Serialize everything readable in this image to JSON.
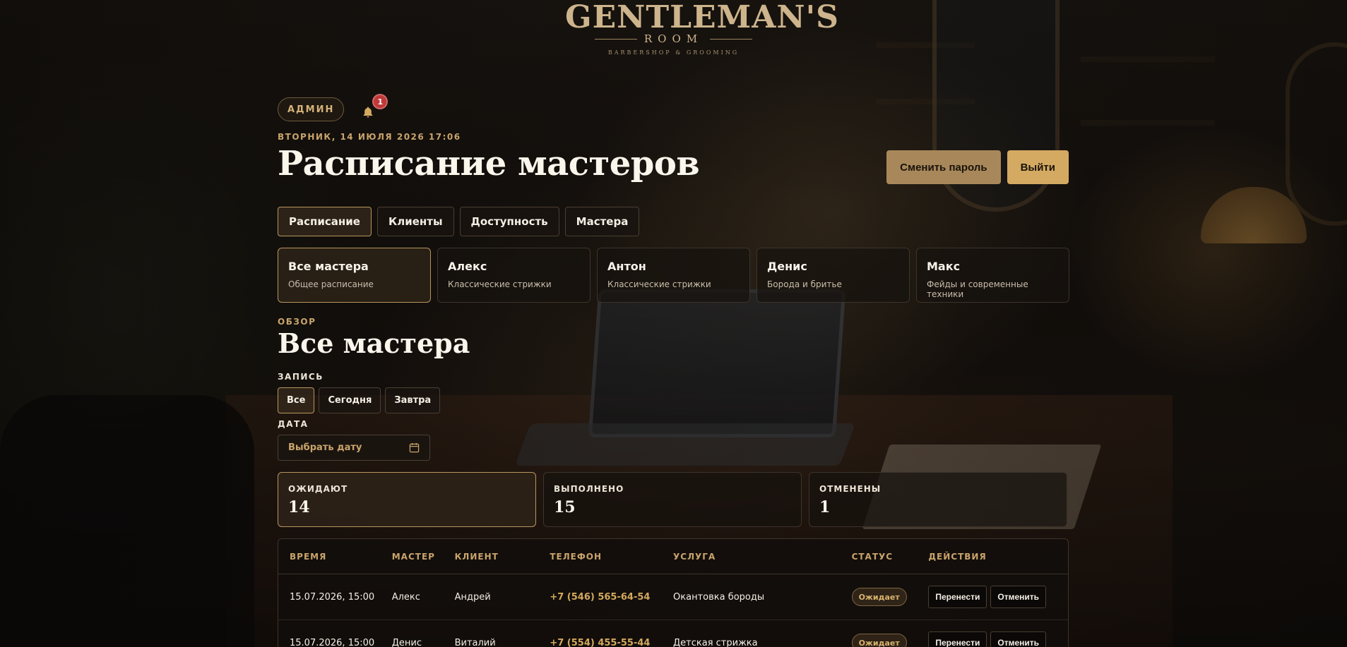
{
  "brand": {
    "line1": "GENTLEMAN'S",
    "line2": "ROOM",
    "line3": "BARBERSHOP & GROOMING"
  },
  "header": {
    "role_badge": "АДМИН",
    "notification_count": "1",
    "date": "ВТОРНИК, 14 ИЮЛЯ 2026 17:06",
    "title": "Расписание мастеров",
    "change_password_label": "Сменить пароль",
    "logout_label": "Выйти"
  },
  "tabs": [
    {
      "label": "Расписание",
      "active": true
    },
    {
      "label": "Клиенты",
      "active": false
    },
    {
      "label": "Доступность",
      "active": false
    },
    {
      "label": "Мастера",
      "active": false
    }
  ],
  "masters": [
    {
      "name": "Все мастера",
      "desc": "Общее расписание",
      "active": true
    },
    {
      "name": "Алекс",
      "desc": "Классические стрижки",
      "active": false
    },
    {
      "name": "Антон",
      "desc": "Классические стрижки",
      "active": false
    },
    {
      "name": "Денис",
      "desc": "Борода и бритье",
      "active": false
    },
    {
      "name": "Макс",
      "desc": "Фейды и современные техники",
      "active": false
    }
  ],
  "overview": {
    "label": "ОБЗОР",
    "title": "Все мастера",
    "record_label": "ЗАПИСЬ",
    "filters": [
      {
        "label": "Все",
        "active": true
      },
      {
        "label": "Сегодня",
        "active": false
      },
      {
        "label": "Завтра",
        "active": false
      }
    ],
    "date_label": "ДАТА",
    "date_placeholder": "Выбрать дату"
  },
  "stats": [
    {
      "label": "ОЖИДАЮТ",
      "value": "14",
      "active": true
    },
    {
      "label": "ВЫПОЛНЕНО",
      "value": "15",
      "active": false
    },
    {
      "label": "ОТМЕНЕНЫ",
      "value": "1",
      "active": false
    }
  ],
  "table": {
    "columns": [
      "ВРЕМЯ",
      "МАСТЕР",
      "КЛИЕНТ",
      "ТЕЛЕФОН",
      "УСЛУГА",
      "СТАТУС",
      "ДЕЙСТВИЯ"
    ],
    "reschedule_label": "Перенести",
    "cancel_label": "Отменить",
    "rows": [
      {
        "time": "15.07.2026, 15:00",
        "master": "Алекс",
        "client": "Андрей",
        "phone": "+7 (546) 565-64-54",
        "service": "Окантовка бороды",
        "status": "Ожидает"
      },
      {
        "time": "15.07.2026, 15:00",
        "master": "Денис",
        "client": "Виталий",
        "phone": "+7 (554) 455-55-44",
        "service": "Детская стрижка",
        "status": "Ожидает"
      }
    ]
  },
  "colors": {
    "accent": "#d4aa62",
    "accent_muted": "#a8885a",
    "notification": "#c03838"
  },
  "icons": {
    "bell": "bell-icon",
    "calendar": "calendar-icon"
  }
}
